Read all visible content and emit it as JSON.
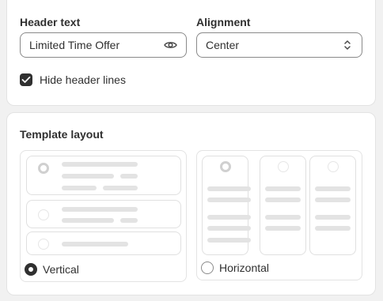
{
  "header_field": {
    "label": "Header text",
    "value": "Limited Time Offer",
    "icon": "eye-icon"
  },
  "alignment_field": {
    "label": "Alignment",
    "value": "Center",
    "icon": "select-chevrons-icon"
  },
  "hide_header_lines": {
    "label": "Hide header lines",
    "checked": true
  },
  "template_layout": {
    "title": "Template layout",
    "options": [
      {
        "label": "Vertical",
        "selected": true
      },
      {
        "label": "Horizontal",
        "selected": false
      }
    ]
  },
  "colors": {
    "text": "#303030",
    "border": "#e3e3e3",
    "placeholder_bar": "#e3e3e3",
    "page_bg": "#f1f1f1"
  }
}
